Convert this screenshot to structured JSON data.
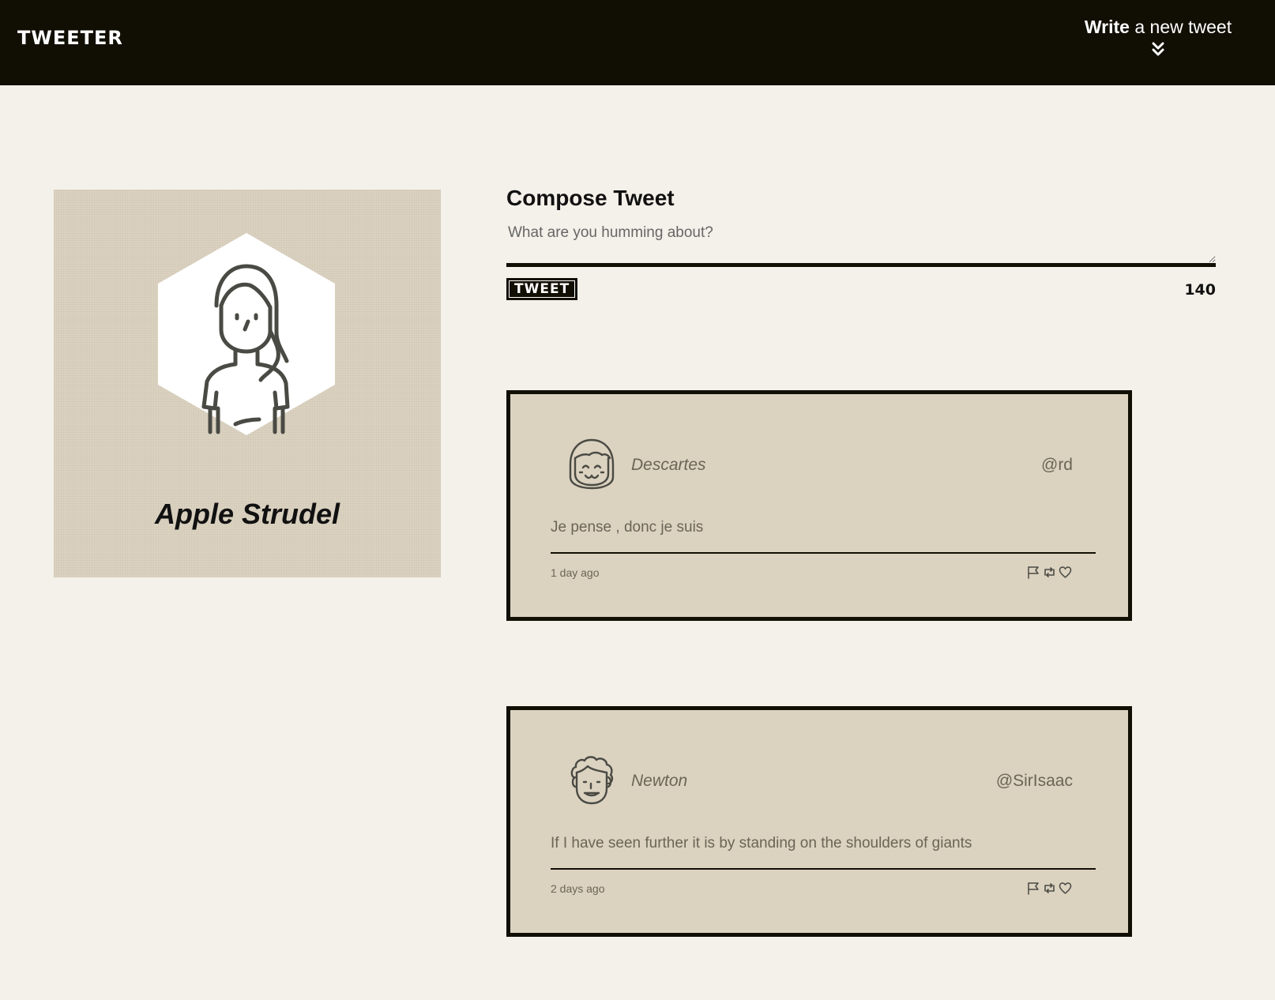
{
  "nav": {
    "brand": "TWEETER",
    "compose_bold": "Write",
    "compose_rest": " a new tweet",
    "toggle_icon": "double-chevron-down-icon"
  },
  "profile": {
    "name": "Apple Strudel",
    "avatar_icon": "woman-avatar-icon"
  },
  "compose": {
    "title": "Compose Tweet",
    "placeholder": "What are you humming about?",
    "value": "",
    "button_label": "TWEET",
    "counter": "140"
  },
  "tweets": [
    {
      "name": "Descartes",
      "handle": "@rd",
      "text": "Je pense , donc je suis",
      "time": "1 day ago",
      "avatar_icon": "girl-avatar-icon"
    },
    {
      "name": "Newton",
      "handle": "@SirIsaac",
      "text": "If I have seen further it is by standing on the shoulders of giants",
      "time": "2 days ago",
      "avatar_icon": "curly-hair-avatar-icon"
    }
  ],
  "tweet_actions": [
    "flag-icon",
    "retweet-icon",
    "heart-icon"
  ],
  "colors": {
    "nav_background": "#110f04",
    "page_background": "#f4f1ea",
    "card_background": "#dbd2c0",
    "muted_text": "#6b6555"
  }
}
